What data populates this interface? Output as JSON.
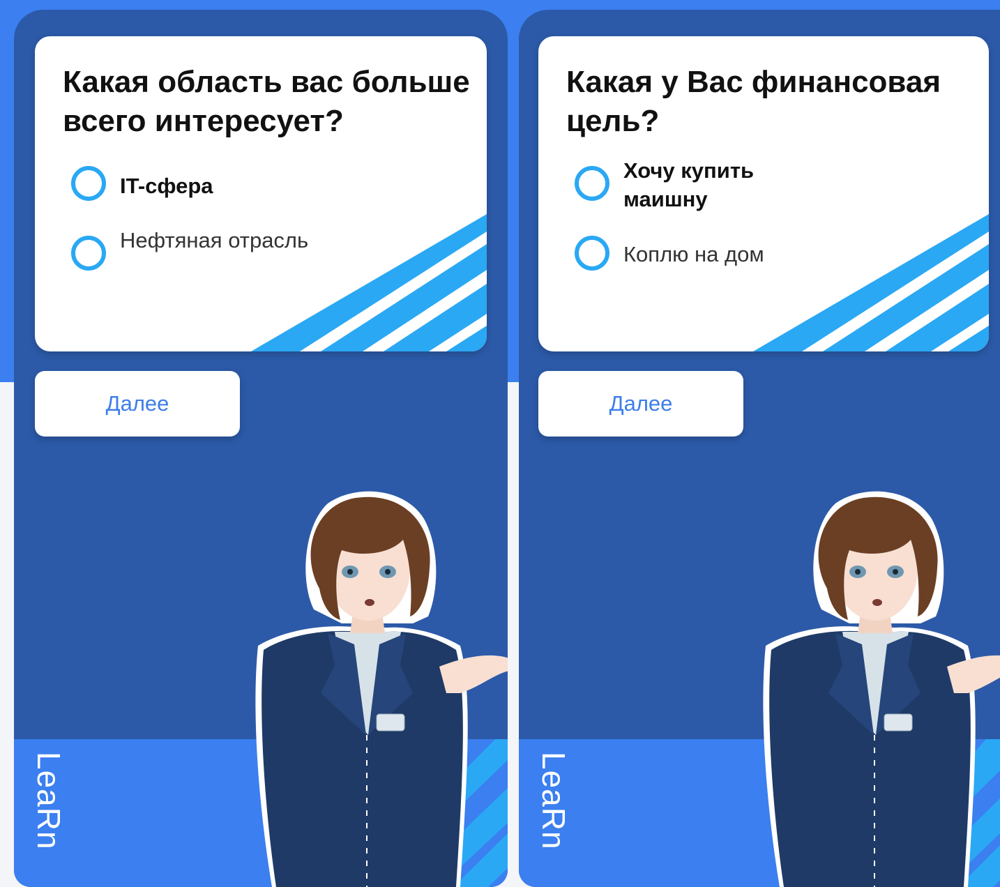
{
  "screens": [
    {
      "question": "Какая область вас больше всего интересует?",
      "options": [
        {
          "label": "IT-сфера",
          "bold": true
        },
        {
          "label": "Нефтяная отрасль",
          "bold": false
        }
      ],
      "next_label": "Далее",
      "brand": "LeaRn"
    },
    {
      "question": "Какая у Вас финансовая цель?",
      "options": [
        {
          "label": "Хочу купить маишну",
          "bold": true
        },
        {
          "label": "Коплю на дом",
          "bold": false
        }
      ],
      "next_label": "Далее",
      "brand": "LeaRn"
    }
  ],
  "colors": {
    "page_accent": "#3b7ff0",
    "phone_bg": "#2c5aa8",
    "radio": "#2aa8f4",
    "stripe": "#2aa8f4",
    "button_text": "#3d7ee8",
    "jacket": "#1f3a66",
    "hair": "#6b3f24"
  },
  "icons": {
    "radio": "radio-unchecked-icon",
    "character": "assistant-character-illustration"
  }
}
